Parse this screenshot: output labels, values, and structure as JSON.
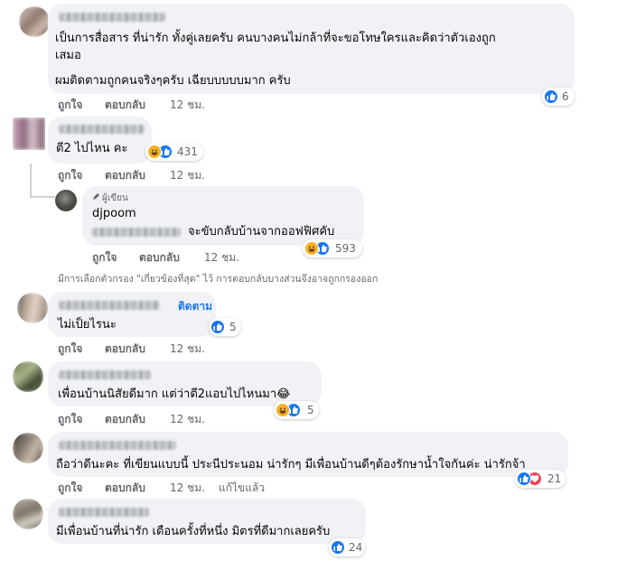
{
  "comments": [
    {
      "text": [
        "เป็นการสื่อสาร ที่น่ารัก ทั้งคู่เลยครับ คนบางคนไม่กล้าที่จะขอโทษใครและคิดว่าตัวเองถูก",
        "เสมอ",
        "ผมติดตามถูกคนจริงๆครับ เฉียบบบบบมาก ครับ"
      ],
      "like": "ถูกใจ",
      "reply": "ตอบกลับ",
      "time": "12 ชม.",
      "reactions": [
        "like"
      ],
      "count": "6"
    },
    {
      "text": [
        "ตี2 ไปไหน คะ"
      ],
      "like": "ถูกใจ",
      "reply": "ตอบกลับ",
      "time": "12 ชม.",
      "reactions": [
        "haha",
        "like"
      ],
      "count": "431"
    },
    {
      "badge": "ผู้เขียน",
      "author": "djpoom",
      "text": [
        "จะขับกลับบ้านจากออฟฟิศคับ"
      ],
      "like": "ถูกใจ",
      "reply": "ตอบกลับ",
      "time": "12 ชม.",
      "reactions": [
        "haha",
        "like"
      ],
      "count": "593"
    },
    {
      "follow": "ติดตาม",
      "text": [
        "ไม่เป็ยไรนะ"
      ],
      "like": "ถูกใจ",
      "reply": "ตอบกลับ",
      "time": "12 ชม.",
      "reactions": [
        "like"
      ],
      "count": "5"
    },
    {
      "text": [
        "เพื่อนบ้านนิสัยดีมาก แต่ว่าตี2แอบไปไหนมา😂"
      ],
      "like": "ถูกใจ",
      "reply": "ตอบกลับ",
      "time": "12 ชม.",
      "reactions": [
        "haha",
        "like"
      ],
      "count": "5"
    },
    {
      "text": [
        "ถือว่าดีนะคะ ที่เขียนแบบนี้ ประนีประนอม น่ารักๆ มีเพื่อนบ้านดีๆต้องรักษาน้ำใจกันค่ะ น่ารักจ้า"
      ],
      "like": "ถูกใจ",
      "reply": "ตอบกลับ",
      "time": "12 ชม.",
      "edited": "แก้ไขแล้ว",
      "reactions": [
        "like",
        "love"
      ],
      "count": "21"
    },
    {
      "text": [
        "มีเพื่อนบ้านที่น่ารัก เตือนครั้งที่หนึ่ง มิตรที่ดีมากเลยครับ"
      ],
      "like": "ถูกใจ",
      "reply": "ตอบกลับ",
      "time": "12 ชม.",
      "reactions": [
        "like"
      ],
      "count": "24"
    }
  ],
  "filter_notice": "มีการเลือกตัวกรอง \"เกี่ยวข้องที่สุด\" ไว้ การตอบกลับบางส่วนจึงอาจถูกกรองออก",
  "colors": {
    "like": "#1877f2",
    "haha": "#f7b125",
    "love": "#f33e58",
    "bubble": "#f0f2f5",
    "meta": "#65676b",
    "follow": "#1877f2"
  }
}
